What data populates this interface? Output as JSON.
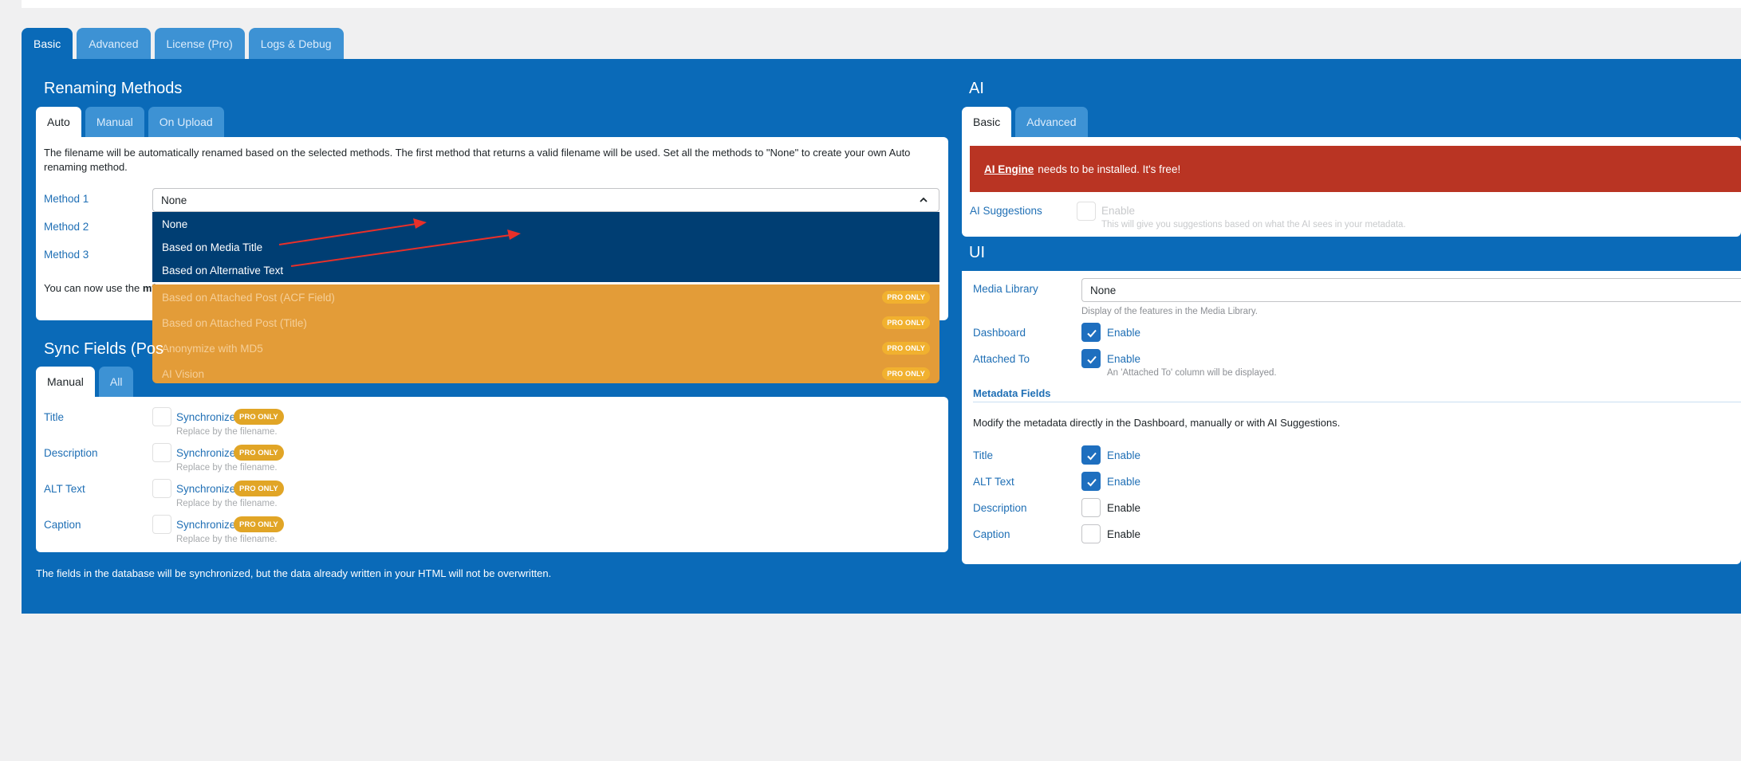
{
  "top_tabs": [
    {
      "label": "Basic",
      "active": true
    },
    {
      "label": "Advanced",
      "active": false
    },
    {
      "label": "License (Pro)",
      "active": false
    },
    {
      "label": "Logs & Debug",
      "active": false
    }
  ],
  "renaming": {
    "title": "Renaming Methods",
    "tabs": [
      {
        "label": "Auto",
        "active": true
      },
      {
        "label": "Manual",
        "active": false
      },
      {
        "label": "On Upload",
        "active": false
      }
    ],
    "description": "The filename will be automatically renamed based on the selected methods. The first method that returns a valid filename will be used. Set all the methods to \"None\" to create your own Auto renaming method.",
    "method1_label": "Method 1",
    "method2_label": "Method 2",
    "method3_label": "Method 3",
    "method1_value": "None",
    "note_partial": "You can now use the",
    "note_bold": "mf",
    "options": [
      {
        "label": "None",
        "pro": false
      },
      {
        "label": "Based on Media Title",
        "pro": false
      },
      {
        "label": "Based on Alternative Text",
        "pro": false
      },
      {
        "label": "Based on Attached Post (ACF Field)",
        "pro": true
      },
      {
        "label": "Based on Attached Post (Title)",
        "pro": true
      },
      {
        "label": "Anonymize with MD5",
        "pro": true
      },
      {
        "label": "AI Vision",
        "pro": true
      }
    ],
    "pro_badge": "PRO ONLY"
  },
  "sync": {
    "title": "Sync Fields (Pos",
    "tabs": [
      {
        "label": "Manual",
        "active": true
      },
      {
        "label": "All",
        "active": false
      }
    ],
    "fields": [
      {
        "label": "Title",
        "checkbox": "Synchronize",
        "pill": "PRO ONLY",
        "help": "Replace by the filename."
      },
      {
        "label": "Description",
        "checkbox": "Synchronize",
        "pill": "PRO ONLY",
        "help": "Replace by the filename."
      },
      {
        "label": "ALT Text",
        "checkbox": "Synchronize",
        "pill": "PRO ONLY",
        "help": "Replace by the filename."
      },
      {
        "label": "Caption",
        "checkbox": "Synchronize",
        "pill": "PRO ONLY",
        "help": "Replace by the filename."
      }
    ],
    "footer_note": "The fields in the database will be synchronized, but the data already written in your HTML will not be overwritten."
  },
  "ai": {
    "title": "AI",
    "tabs": [
      {
        "label": "Basic",
        "active": true
      },
      {
        "label": "Advanced",
        "active": false
      }
    ],
    "alert_link": "AI Engine",
    "alert_text": "needs to be installed. It's free!",
    "suggestions_label": "AI Suggestions",
    "suggestions_checkbox": "Enable",
    "suggestions_help": "This will give you suggestions based on what the AI sees in your metadata."
  },
  "ui": {
    "title": "UI",
    "media_library_label": "Media Library",
    "media_library_value": "None",
    "media_library_help": "Display of the features in the Media Library.",
    "dashboard_label": "Dashboard",
    "dashboard_checkbox": "Enable",
    "attached_to_label": "Attached To",
    "attached_to_checkbox": "Enable",
    "attached_to_help": "An 'Attached To' column will be displayed.",
    "metadata_title": "Metadata Fields",
    "metadata_description": "Modify the metadata directly in the Dashboard, manually or with AI Suggestions.",
    "metadata_fields": [
      {
        "label": "Title",
        "checkbox": "Enable",
        "checked": true
      },
      {
        "label": "ALT Text",
        "checkbox": "Enable",
        "checked": true
      },
      {
        "label": "Description",
        "checkbox": "Enable",
        "checked": false
      },
      {
        "label": "Caption",
        "checkbox": "Enable",
        "checked": false
      }
    ]
  },
  "colors": {
    "panel": "#0a6ab8",
    "dropdown_free": "#003e73",
    "dropdown_pro": "#e39c38",
    "alert": "#b93423",
    "arrow": "#e8302a"
  }
}
